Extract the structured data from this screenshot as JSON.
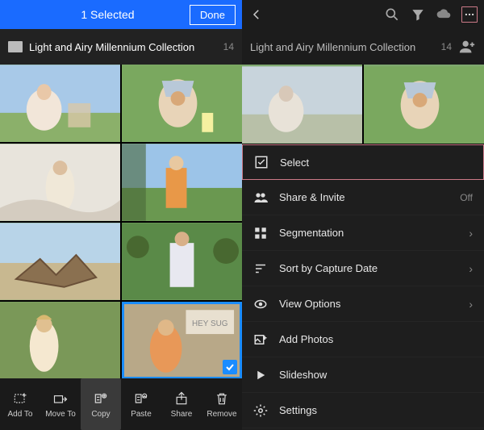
{
  "left": {
    "selection_status": "1 Selected",
    "done_label": "Done",
    "album_title": "Light and Airy Millennium Collection",
    "album_count": "14",
    "actions": {
      "add_to": "Add To",
      "move_to": "Move To",
      "copy": "Copy",
      "paste": "Paste",
      "share": "Share",
      "remove": "Remove"
    }
  },
  "right": {
    "album_title": "Light and Airy Millennium Collection",
    "album_count": "14",
    "menu": {
      "select": "Select",
      "share": "Share & Invite",
      "share_state": "Off",
      "segmentation": "Segmentation",
      "sort": "Sort by Capture Date",
      "view": "View Options",
      "add": "Add Photos",
      "slideshow": "Slideshow",
      "settings": "Settings"
    }
  }
}
